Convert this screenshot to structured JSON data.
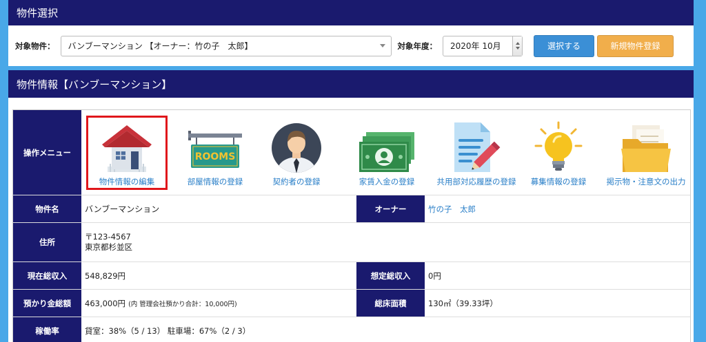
{
  "selection": {
    "title": "物件選択",
    "property_label": "対象物件：",
    "property_value": "バンブーマンション 【オーナー：竹の子　太郎】",
    "year_label": "対象年度：",
    "year_value": "2020年 10月",
    "select_button": "選択する",
    "new_button": "新規物件登録"
  },
  "info": {
    "title": "物件情報【バンブーマンション】",
    "menu_label": "操作メニュー",
    "menu": [
      {
        "label": "物件情報の編集",
        "icon": "house-icon"
      },
      {
        "label": "部屋情報の登録",
        "icon": "rooms-sign-icon"
      },
      {
        "label": "契約者の登録",
        "icon": "person-icon"
      },
      {
        "label": "家賃入金の登録",
        "icon": "money-icon"
      },
      {
        "label": "共用部対応履歴の登録",
        "icon": "document-pen-icon"
      },
      {
        "label": "募集情報の登録",
        "icon": "lightbulb-icon"
      },
      {
        "label": "掲示物・注意文の出力",
        "icon": "folder-icon"
      }
    ],
    "rooms_sign_text": "ROOMS",
    "property_name_label": "物件名",
    "property_name": "バンブーマンション",
    "owner_label": "オーナー",
    "owner": "竹の子　太郎",
    "address_label": "住所",
    "postal": "〒123-4567",
    "address": "東京都杉並区",
    "income_label": "現在総収入",
    "income": "548,829円",
    "expected_label": "想定総収入",
    "expected": "0円",
    "deposit_label": "預かり金総額",
    "deposit": "463,000円",
    "deposit_note": "(内 管理会社預かり合計：10,000円)",
    "area_label": "総床面積",
    "area": "130㎡（39.33坪）",
    "occupancy_label": "稼働率",
    "occupancy": "貸室：38%（5 / 13） 駐車場：67%（2 / 3）"
  },
  "colors": {
    "header_navy": "#1a1a6e",
    "background_blue": "#49a8e8",
    "button_blue": "#3b8fd6",
    "button_orange": "#f1ae4b",
    "link_blue": "#2a7fc8",
    "highlight_red": "#e0161b"
  }
}
